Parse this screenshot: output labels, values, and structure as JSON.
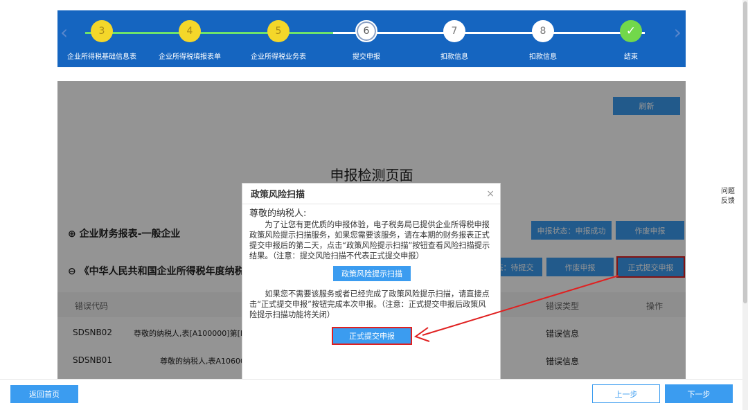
{
  "stepper": {
    "steps": [
      {
        "num": "3",
        "label": "企业所得税基础信息表",
        "state": "done"
      },
      {
        "num": "4",
        "label": "企业所得税填报表单",
        "state": "done"
      },
      {
        "num": "5",
        "label": "企业所得税业务表",
        "state": "done"
      },
      {
        "num": "6",
        "label": "提交申报",
        "state": "current"
      },
      {
        "num": "7",
        "label": "扣款信息",
        "state": "todo"
      },
      {
        "num": "8",
        "label": "扣款信息",
        "state": "todo"
      },
      {
        "num": "✓",
        "label": "结束",
        "state": "finish"
      }
    ],
    "prev_icon": "chevron-left-icon",
    "next_icon": "chevron-right-icon"
  },
  "main": {
    "refresh_label": "刷新",
    "page_title": "申报检测页面",
    "section1": {
      "title": "企业财务报表-一般企业",
      "status_label": "申报状态：申报成功",
      "void_label": "作废申报"
    },
    "section2": {
      "title": "《中华人民共和国企业所得税年度纳税申",
      "status_label": "态：待提交",
      "void_label": "作废申报",
      "submit_label": "正式提交申报"
    },
    "table": {
      "headers": {
        "code": "错误代码",
        "type": "错误类型",
        "action": "操作"
      },
      "rows": [
        {
          "code": "SDSNB02",
          "desc": "尊敬的纳税人,表[A100000]第[H2",
          "type": "错误信息"
        },
        {
          "code": "SDSNB01",
          "desc": "尊敬的纳税人,表A106000",
          "type": "错误信息"
        }
      ]
    }
  },
  "dialog": {
    "title": "政策风险扫描",
    "close": "×",
    "greeting": "尊敬的纳税人:",
    "paragraph1": "为了让您有更优质的申报体验，电子税务局已提供企业所得税申报政策风险提示扫描服务，如果您需要该服务，请在本期的财务报表正式提交申报后的第二天，点击“政策风险提示扫描”按钮查看风险扫描提示结果。（注意：提交风险扫描不代表正式提交申报）",
    "scan_button": "政策风险提示扫描",
    "paragraph2": "如果您不需要该服务或者已经完成了政策风险提示扫描，请直接点击“正式提交申报”按钮完成本次申报。（注意：正式提交申报后政策风险提示扫描功能将关闭）",
    "submit_button": "正式提交申报"
  },
  "feedback": {
    "line1": "问题",
    "line2": "反馈"
  },
  "footer": {
    "home": "返回首页",
    "prev": "上一步",
    "next": "下一步"
  },
  "colors": {
    "primary": "#3b9cf0",
    "stepper_bg": "#1565c0",
    "done": "#f4d72a",
    "finish": "#72d84b",
    "annotation": "#e02020"
  }
}
